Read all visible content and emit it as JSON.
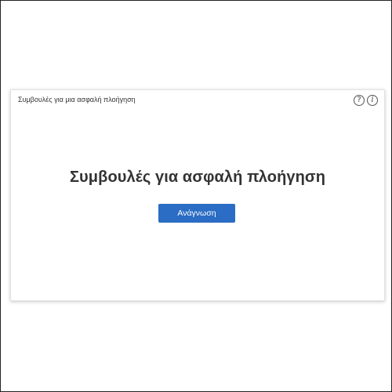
{
  "card": {
    "header_title": "Συμβουλές για μια ασφαλή πλοήγηση",
    "icons": [
      "help-icon",
      "info-icon"
    ],
    "heading": "Συμβουλές για ασφαλή πλοήγηση",
    "button_label": "Ανάγνωση"
  },
  "colors": {
    "button": "#2b6cc4",
    "heading": "#333333"
  }
}
